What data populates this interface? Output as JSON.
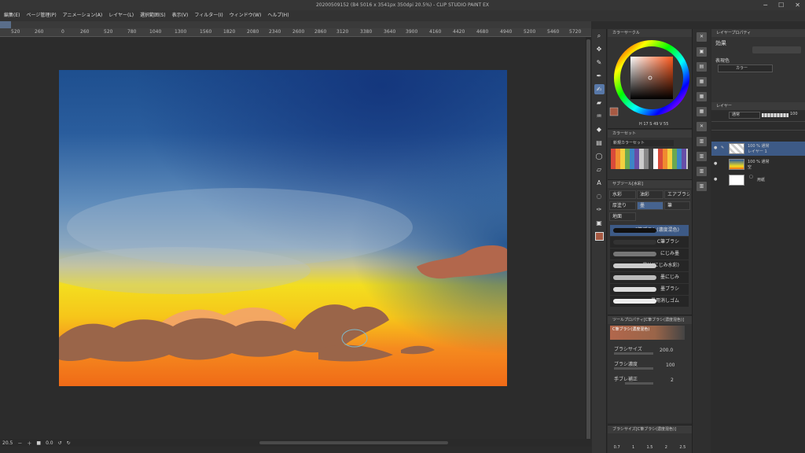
{
  "window": {
    "title": "20200509152 (B4 5016 x 3541px 350dpi 20.5%) - CLIP STUDIO PAINT EX",
    "controls": [
      "─",
      "☐",
      "✕"
    ]
  },
  "menu": [
    "編集(E)",
    "ページ管理(P)",
    "アニメーション(A)",
    "レイヤー(L)",
    "選択範囲(S)",
    "表示(V)",
    "フィルター(I)",
    "ウィンドウ(W)",
    "ヘルプ(H)"
  ],
  "ruler": {
    "ticks": [
      "520",
      "260",
      "0",
      "260",
      "520",
      "780",
      "1040",
      "1300",
      "1560",
      "1820",
      "2080",
      "2340",
      "2600",
      "2860",
      "3120",
      "3380",
      "3640",
      "3900",
      "4160",
      "4420",
      "4680",
      "4940",
      "5200",
      "5460",
      "5720"
    ]
  },
  "status": {
    "zoom": "20.5",
    "angle": "0.0"
  },
  "color_panel": {
    "title": "カラーサークル",
    "readout": "H 17  S 49  V 55",
    "main_color": "#a75a43"
  },
  "colorset_panel": {
    "title": "カラーセット",
    "name": "新規カラーセット"
  },
  "subtool_panel": {
    "title": "サブツール[水彩]",
    "tabs": [
      "水彩",
      "油彩",
      "エアブラシ",
      "厚塗り",
      "墨",
      "筆",
      "地面"
    ],
    "active_tab": "墨"
  },
  "brushes": [
    {
      "label": "C筆ブラシ(濃度混色)",
      "selected": true
    },
    {
      "label": "C筆ブラシ",
      "selected": false
    },
    {
      "label": "にじみ墨",
      "selected": false
    },
    {
      "label": "墨汁(にじみ水彩)",
      "selected": false
    },
    {
      "label": "墨にじみ",
      "selected": false
    },
    {
      "label": "墨ブラシ",
      "selected": false
    },
    {
      "label": "墨用消しゴム",
      "selected": false
    }
  ],
  "tool_property": {
    "title": "ツールプロパティ[C筆ブラシ(濃度混色)]",
    "brush_name": "C筆ブラシ(濃度混色)",
    "brush_size_label": "ブラシサイズ",
    "brush_size": "200.0",
    "density_label": "ブラシ濃度",
    "density": "100",
    "stabilize_label": "手ブレ補正",
    "stabilize": "2"
  },
  "brush_size_panel": {
    "title": "ブラシサイズ[C筆ブラシ(濃度混色)]",
    "sizes": [
      "0.7",
      "1",
      "1.5",
      "2",
      "2.5"
    ]
  },
  "layer_property": {
    "title": "レイヤープロパティ",
    "effect_label": "効果",
    "display_color_label": "表現色",
    "display_color_value": "カラー"
  },
  "layer_panel": {
    "title": "レイヤー",
    "blend_mode": "通常",
    "opacity": "100",
    "layers": [
      {
        "line1": "100 % 通常",
        "line2": "レイヤー 1",
        "selected": true
      },
      {
        "line1": "100 % 通常",
        "line2": "空",
        "selected": false
      },
      {
        "line1": "",
        "line2": "用紙",
        "selected": false
      }
    ]
  }
}
